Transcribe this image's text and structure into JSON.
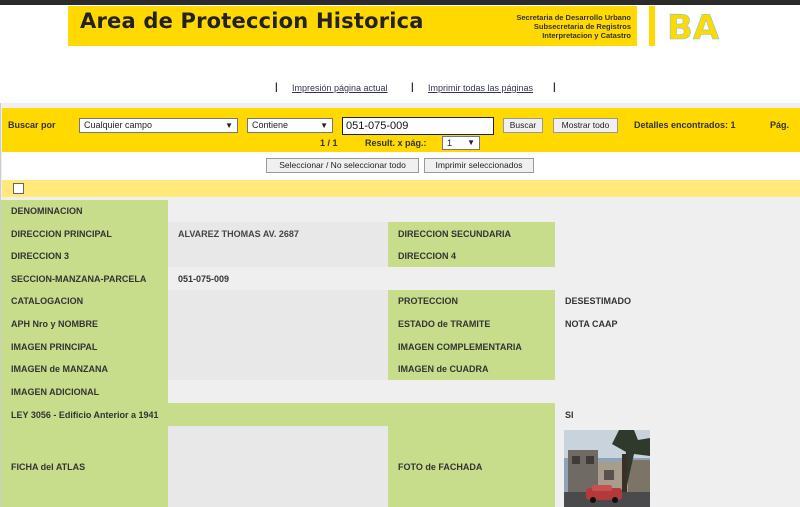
{
  "header": {
    "title": "Area de Proteccion Historica",
    "subtitle_lines": [
      "Secretaria de Desarrollo Urbano",
      "Subsecretaria de Registros",
      "Interpretacion y Catastro"
    ],
    "logo_text": "BA"
  },
  "links": {
    "print_current": "Impresión página actual",
    "print_all": "Imprimir todas las páginas"
  },
  "search": {
    "label": "Buscar por",
    "field_select": "Cualquier campo",
    "operator_select": "Contiene",
    "query": "051-075-009",
    "search_button": "Buscar",
    "show_all_button": "Mostrar todo",
    "found_label": "Detalles encontrados: 1",
    "page_label": "Pág.",
    "pagination": "1 / 1",
    "results_per_page_label": "Result. x pág.:",
    "results_per_page": "1"
  },
  "selection": {
    "toggle_all_button": "Seleccionar / No seleccionar todo",
    "print_selected_button": "Imprimir seleccionados"
  },
  "record": {
    "denominacion_label": "DENOMINACION",
    "denominacion_value": "",
    "direccion_principal_label": "DIRECCION PRINCIPAL",
    "direccion_principal_value": "ALVAREZ THOMAS AV. 2687",
    "direccion_secundaria_label": "DIRECCION SECUNDARIA",
    "direccion_secundaria_value": "",
    "direccion3_label": "DIRECCION 3",
    "direccion3_value": "",
    "direccion4_label": "DIRECCION 4",
    "direccion4_value": "",
    "smp_label": "SECCION-MANZANA-PARCELA",
    "smp_value": "051-075-009",
    "catalogacion_label": "CATALOGACION",
    "catalogacion_value": "",
    "proteccion_label": "PROTECCION",
    "proteccion_value": "DESESTIMADO",
    "aph_label": "APH Nro y NOMBRE",
    "aph_value": "",
    "estado_label": "ESTADO de TRAMITE",
    "estado_value": "NOTA CAAP",
    "imagen_principal_label": "IMAGEN PRINCIPAL",
    "imagen_principal_value": "",
    "imagen_complementaria_label": "IMAGEN COMPLEMENTARIA",
    "imagen_complementaria_value": "",
    "imagen_manzana_label": "IMAGEN de MANZANA",
    "imagen_manzana_value": "",
    "imagen_cuadra_label": "IMAGEN de CUADRA",
    "imagen_cuadra_value": "",
    "imagen_adicional_label": "IMAGEN ADICIONAL",
    "imagen_adicional_value": "",
    "ley_label": "LEY 3056 - Edificio Anterior a 1941",
    "ley_value": "SI",
    "ficha_label": "FICHA del ATLAS",
    "ficha_value": "",
    "foto_label": "FOTO de FACHADA"
  },
  "colors": {
    "brand_yellow": "#ffd900",
    "label_green": "#c7dd8c",
    "value_gray": "#e8e8e8"
  }
}
